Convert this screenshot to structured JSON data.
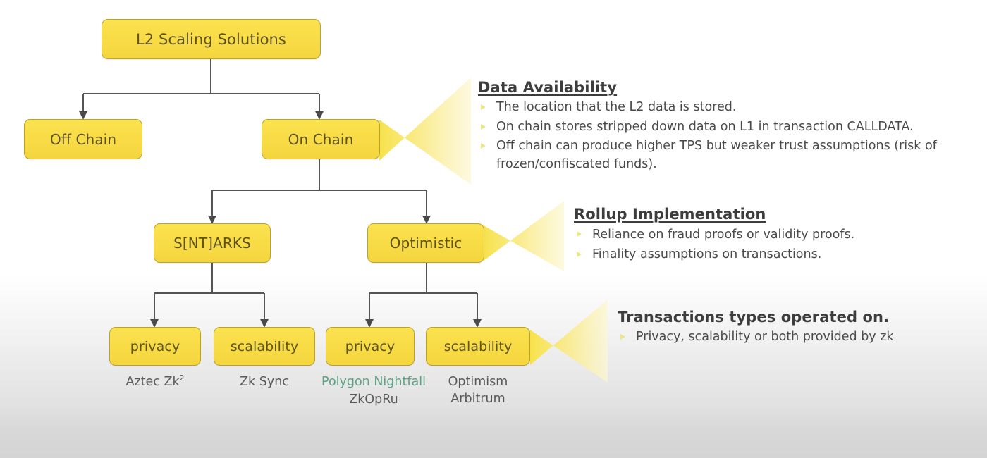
{
  "diagram": {
    "title": "L2 Scaling Solutions tree",
    "colors": {
      "node_fill": "#F8DC4C",
      "node_border": "#B9A22D",
      "node_text": "#5D5322",
      "connector": "#555555",
      "callout_gradient_start": "#F7E24B",
      "callout_gradient_end": "#FCF6C9",
      "bullet": "#ECE58E",
      "caption_text": "#595959",
      "caption_green": "#5DA184",
      "heading_text": "#3D3D3D"
    },
    "nodes": {
      "root": {
        "label": "L2 Scaling Solutions"
      },
      "level2": [
        {
          "label": "Off Chain"
        },
        {
          "label": "On Chain"
        }
      ],
      "level3": [
        {
          "label": "S[NT]ARKS"
        },
        {
          "label": "Optimistic"
        }
      ],
      "level4": [
        {
          "label": "privacy"
        },
        {
          "label": "scalability"
        },
        {
          "label": "privacy"
        },
        {
          "label": "scalability"
        }
      ]
    },
    "leaf_captions": [
      {
        "lines": [
          "Aztec Zk2"
        ],
        "html": "Aztec Zk<sup>2</sup>",
        "green": false
      },
      {
        "lines": [
          "Zk Sync"
        ],
        "html": "Zk Sync",
        "green": false
      },
      {
        "lines": [
          "Polygon Nightfall"
        ],
        "html": "Polygon Nightfall",
        "green": true
      },
      {
        "lines": [
          "ZkOpRu"
        ],
        "html": "ZkOpRu",
        "green": false
      },
      {
        "lines": [
          "Optimism",
          "Arbitrum"
        ],
        "html": "Optimism<br>Arbitrum",
        "green": false
      }
    ]
  },
  "callouts": [
    {
      "title": "Data Availability",
      "underlined": true,
      "bullets": [
        "The location that the L2 data is stored.",
        "On chain stores stripped down data on L1 in transaction CALLDATA.",
        "Off chain can produce higher TPS but weaker trust assumptions (risk of frozen/confiscated funds)."
      ]
    },
    {
      "title": "Rollup Implementation",
      "underlined": true,
      "bullets": [
        "Reliance on fraud proofs or validity proofs.",
        "Finality assumptions on transactions."
      ]
    },
    {
      "title": "Transactions types operated on.",
      "underlined": false,
      "bullets": [
        "Privacy, scalability or both provided by zk"
      ]
    }
  ]
}
